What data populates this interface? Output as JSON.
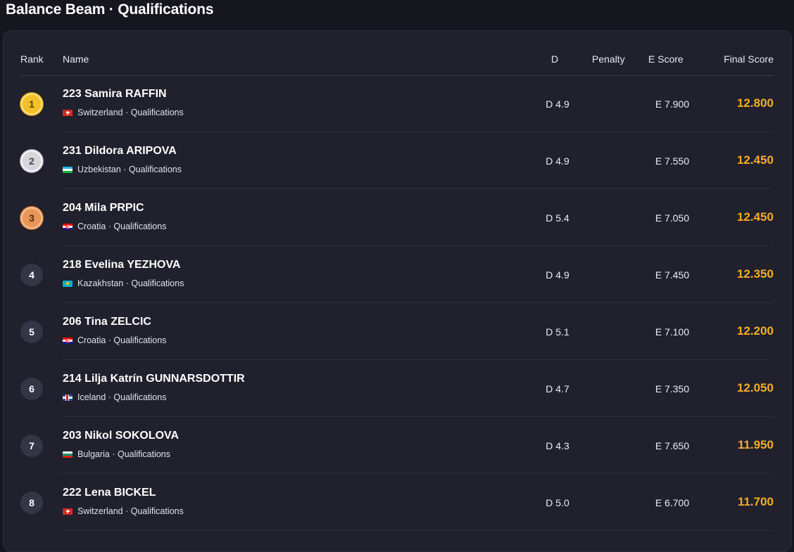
{
  "page": {
    "title": "Balance Beam · Qualifications"
  },
  "table": {
    "headers": {
      "rank": "Rank",
      "name": "Name",
      "d": "D",
      "penalty": "Penalty",
      "e_score": "E Score",
      "final_score": "Final Score"
    },
    "rows": [
      {
        "rank": "1",
        "medal": "gold",
        "name": "223 Samira RAFFIN",
        "flag": "switzerland-flag-icon",
        "country": "Switzerland",
        "sub": "Switzerland · Qualifications",
        "d": "D 4.9",
        "penalty": "",
        "e": "E 7.900",
        "final": "12.800"
      },
      {
        "rank": "2",
        "medal": "silver",
        "name": "231 Dildora ARIPOVA",
        "flag": "uzbekistan-flag-icon",
        "country": "Uzbekistan",
        "sub": "Uzbekistan · Qualifications",
        "d": "D 4.9",
        "penalty": "",
        "e": "E 7.550",
        "final": "12.450"
      },
      {
        "rank": "3",
        "medal": "bronze",
        "name": "204 Mila PRPIC",
        "flag": "croatia-flag-icon",
        "country": "Croatia",
        "sub": "Croatia · Qualifications",
        "d": "D 5.4",
        "penalty": "",
        "e": "E 7.050",
        "final": "12.450"
      },
      {
        "rank": "4",
        "medal": "none",
        "name": "218 Evelina YEZHOVA",
        "flag": "kazakhstan-flag-icon",
        "country": "Kazakhstan",
        "sub": "Kazakhstan · Qualifications",
        "d": "D 4.9",
        "penalty": "",
        "e": "E 7.450",
        "final": "12.350"
      },
      {
        "rank": "5",
        "medal": "none",
        "name": "206 Tina ZELCIC",
        "flag": "croatia-flag-icon",
        "country": "Croatia",
        "sub": "Croatia · Qualifications",
        "d": "D 5.1",
        "penalty": "",
        "e": "E 7.100",
        "final": "12.200"
      },
      {
        "rank": "6",
        "medal": "none",
        "name": "214 Lilja Katrín GUNNARSDOTTIR",
        "flag": "iceland-flag-icon",
        "country": "Iceland",
        "sub": "Iceland · Qualifications",
        "d": "D 4.7",
        "penalty": "",
        "e": "E 7.350",
        "final": "12.050"
      },
      {
        "rank": "7",
        "medal": "none",
        "name": "203 Nikol SOKOLOVA",
        "flag": "bulgaria-flag-icon",
        "country": "Bulgaria",
        "sub": "Bulgaria · Qualifications",
        "d": "D 4.3",
        "penalty": "",
        "e": "E 7.650",
        "final": "11.950"
      },
      {
        "rank": "8",
        "medal": "none",
        "name": "222 Lena BICKEL",
        "flag": "switzerland-flag-icon",
        "country": "Switzerland",
        "sub": "Switzerland · Qualifications",
        "d": "D 5.0",
        "penalty": "",
        "e": "E 6.700",
        "final": "11.700"
      }
    ]
  },
  "colors": {
    "background": "#16161f",
    "panel": "#21212d",
    "final_score": "#f6ad25",
    "gold": "#f2c02b",
    "silver": "#d5d5db",
    "bronze": "#e9965a",
    "rank_chip": "#353545"
  }
}
